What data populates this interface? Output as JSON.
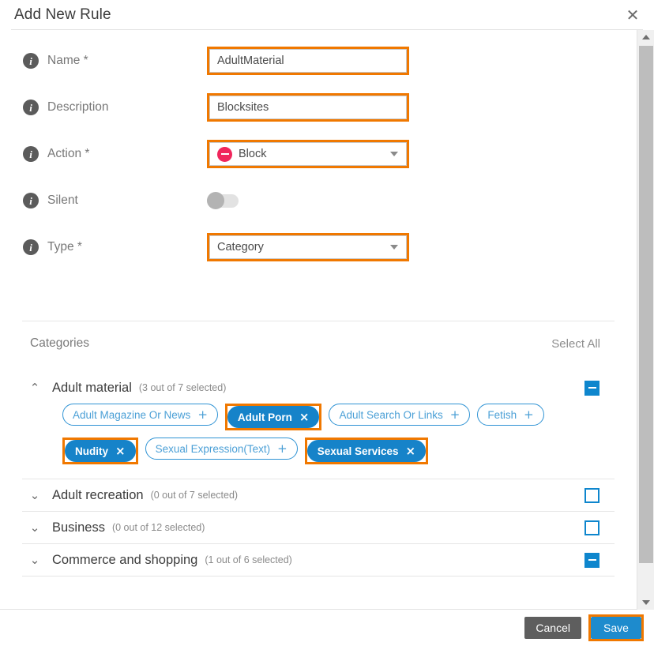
{
  "dialog": {
    "title": "Add New Rule",
    "close_icon": "close-icon"
  },
  "form": {
    "name": {
      "label": "Name *",
      "value": "AdultMaterial",
      "placeholder": ""
    },
    "description": {
      "label": "Description",
      "value": "Blocksites",
      "placeholder": ""
    },
    "action": {
      "label": "Action *",
      "value": "Block",
      "icon": "block-icon",
      "icon_color": "#f0265c"
    },
    "silent": {
      "label": "Silent",
      "state": "off"
    },
    "type": {
      "label": "Type *",
      "value": "Category"
    }
  },
  "categories_panel": {
    "title": "Categories",
    "select_all": "Select All",
    "groups": [
      {
        "name": "Adult material",
        "count": "(3 out of 7 selected)",
        "expanded": true,
        "chevron": "chevron-up-icon",
        "checkbox_state": "partial",
        "chips": [
          {
            "label": "Adult Magazine Or News",
            "selected": false,
            "op": "+",
            "highlighted": false
          },
          {
            "label": "Adult Porn",
            "selected": true,
            "op": "×",
            "highlighted": true
          },
          {
            "label": "Adult Search Or Links",
            "selected": false,
            "op": "+",
            "highlighted": false
          },
          {
            "label": "Fetish",
            "selected": false,
            "op": "+",
            "highlighted": false
          },
          {
            "label": "Nudity",
            "selected": true,
            "op": "×",
            "highlighted": true
          },
          {
            "label": "Sexual Expression(Text)",
            "selected": false,
            "op": "+",
            "highlighted": false
          },
          {
            "label": "Sexual Services",
            "selected": true,
            "op": "×",
            "highlighted": true
          }
        ]
      },
      {
        "name": "Adult recreation",
        "count": "(0 out of 7 selected)",
        "expanded": false,
        "chevron": "chevron-down-icon",
        "checkbox_state": "empty",
        "chips": []
      },
      {
        "name": "Business",
        "count": "(0 out of 12 selected)",
        "expanded": false,
        "chevron": "chevron-down-icon",
        "checkbox_state": "empty",
        "chips": []
      },
      {
        "name": "Commerce and shopping",
        "count": "(1 out of 6 selected)",
        "expanded": false,
        "chevron": "chevron-down-icon",
        "checkbox_state": "partial",
        "chips": []
      }
    ]
  },
  "footer": {
    "cancel_label": "Cancel",
    "save_label": "Save"
  },
  "colors": {
    "highlight": "#f07800",
    "accent_blue": "#1683c9",
    "block_red": "#f0265c",
    "cancel_gray": "#5e5e5e"
  },
  "scrollbar": {
    "up_icon": "scroll-up-arrow-icon",
    "down_icon": "scroll-down-arrow-icon"
  }
}
